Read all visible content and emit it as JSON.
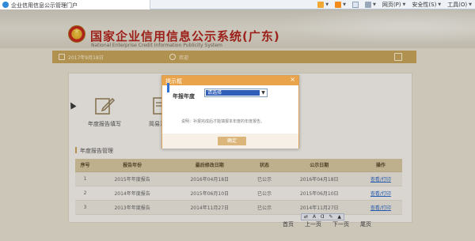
{
  "browser": {
    "tab_title": "企业信用信息公示管理门户",
    "toolbar": {
      "page_label": "网页(P)",
      "safety_label": "安全性(S)",
      "tools_label": "工具(O)"
    }
  },
  "banner": {
    "title": "国家企业信用信息公示系统(广东)",
    "subtitle": "National Enterprise Credit Information Publicity System"
  },
  "navbar": {
    "date": "2017年9月18日",
    "user": "欢迎"
  },
  "shortcuts": [
    {
      "label": "年度报告填写",
      "icon": "edit-report-icon"
    },
    {
      "label": "简易注销",
      "icon": "document-icon"
    }
  ],
  "section_title": "年度报告管理",
  "table": {
    "headers": [
      "序号",
      "报告年份",
      "最后修改日期",
      "状态",
      "公示日期",
      "操作"
    ],
    "rows": [
      {
        "no": "1",
        "year": "2015年年度报告",
        "modified": "2016年04月18日",
        "status": "已公示",
        "published": "2016年04月18日",
        "action": "查看/打印"
      },
      {
        "no": "2",
        "year": "2014年年度报告",
        "modified": "2015年06月10日",
        "status": "已公示",
        "published": "2015年06月10日",
        "action": "查看/打印"
      },
      {
        "no": "3",
        "year": "2013年年度报告",
        "modified": "2014年11月27日",
        "status": "已公示",
        "published": "2014年11月27日",
        "action": "查看/打印"
      }
    ]
  },
  "pager": {
    "first": "首页",
    "prev": "上一页",
    "next": "下一页",
    "last": "尾页"
  },
  "modal": {
    "title": "提示框",
    "close": "×",
    "field_label": "年报年度",
    "select_value": "请选择",
    "note": "说明：补报完成后才能填报本年度的年度报告。",
    "ok_label": "确定"
  },
  "colors": {
    "gold": "#c9a55c",
    "title_red": "#b3261e",
    "modal_header": "#e9a34a",
    "link_blue": "#2d68c4"
  }
}
